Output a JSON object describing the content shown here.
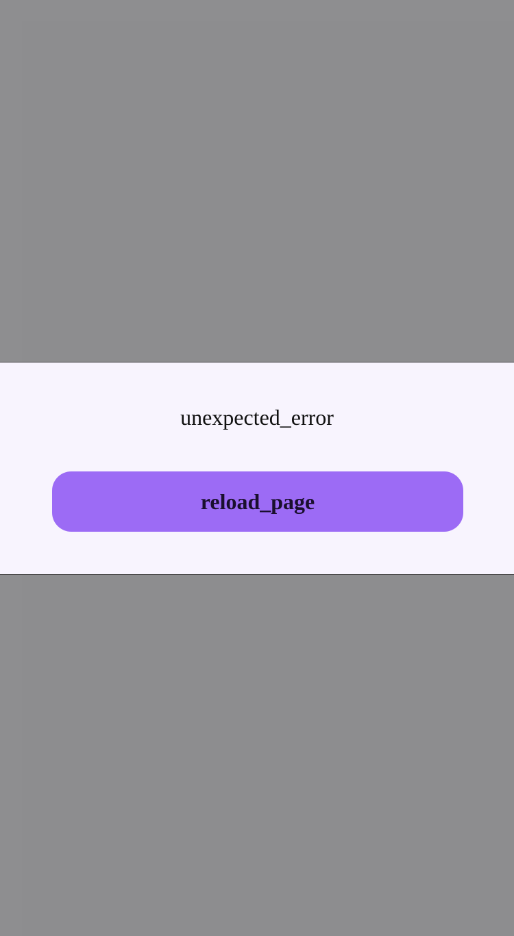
{
  "dialog": {
    "message": "unexpected_error",
    "reload_label": "reload_page"
  },
  "colors": {
    "backdrop": "#8d8d8f",
    "dialog_background": "#f8f4fe",
    "button_background": "#9c6bf5",
    "button_text": "#1a0f2e"
  }
}
